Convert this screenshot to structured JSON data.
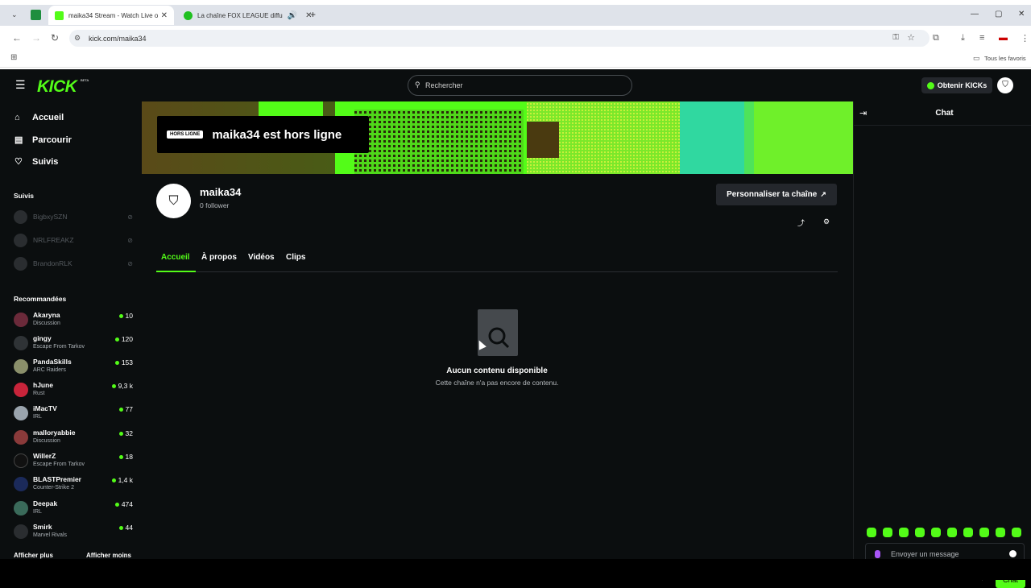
{
  "browser": {
    "tabs": [
      {
        "label": "maika34 Stream - Watch Live o",
        "active": true
      },
      {
        "label": "La chaîne FOX LEAGUE diffu",
        "active": false
      }
    ],
    "url": "kick.com/maika34",
    "bookmarks_label": "Tous les favoris"
  },
  "header": {
    "logo": "KICK",
    "beta": "BETA",
    "search_placeholder": "Rechercher",
    "kicks_button": "Obtenir KICKs"
  },
  "sidebar": {
    "nav": [
      {
        "label": "Accueil",
        "icon": "home-icon"
      },
      {
        "label": "Parcourir",
        "icon": "browse-icon"
      },
      {
        "label": "Suivis",
        "icon": "heart-icon"
      }
    ],
    "followed_title": "Suivis",
    "followed": [
      "BigbxySZN",
      "NRLFREAKZ",
      "BrandonRLK"
    ],
    "recommended_title": "Recommandées",
    "recommended": [
      {
        "name": "Akaryna",
        "category": "Discussion",
        "viewers": "10"
      },
      {
        "name": "gingy",
        "category": "Escape From Tarkov",
        "viewers": "120"
      },
      {
        "name": "PandaSkills",
        "category": "ARC Raiders",
        "viewers": "153"
      },
      {
        "name": "hJune",
        "category": "Rust",
        "viewers": "9,3 k"
      },
      {
        "name": "iMacTV",
        "category": "IRL",
        "viewers": "77"
      },
      {
        "name": "malloryabbie",
        "category": "Discussion",
        "viewers": "32"
      },
      {
        "name": "WillerZ",
        "category": "Escape From Tarkov",
        "viewers": "18"
      },
      {
        "name": "BLASTPremier",
        "category": "Counter-Strike 2",
        "viewers": "1,4 k"
      },
      {
        "name": "Deepak",
        "category": "IRL",
        "viewers": "474"
      },
      {
        "name": "Smirk",
        "category": "Marvel Rivals",
        "viewers": "44"
      }
    ],
    "show_more": "Afficher plus",
    "show_less": "Afficher moins"
  },
  "channel": {
    "offline_badge": "HORS LIGNE",
    "offline_text": "maika34 est hors ligne",
    "name": "maika34",
    "followers": "0 follower",
    "customize_button": "Personnaliser ta chaîne",
    "tabs": [
      "Accueil",
      "À propos",
      "Vidéos",
      "Clips"
    ],
    "empty_title": "Aucun contenu disponible",
    "empty_subtitle": "Cette chaîne n'a pas encore de contenu."
  },
  "chat": {
    "title": "Chat",
    "input_placeholder": "Envoyer un message",
    "send_button": "Chat"
  },
  "colors": {
    "accent": "#53fc18",
    "background": "#0b0e0f"
  }
}
